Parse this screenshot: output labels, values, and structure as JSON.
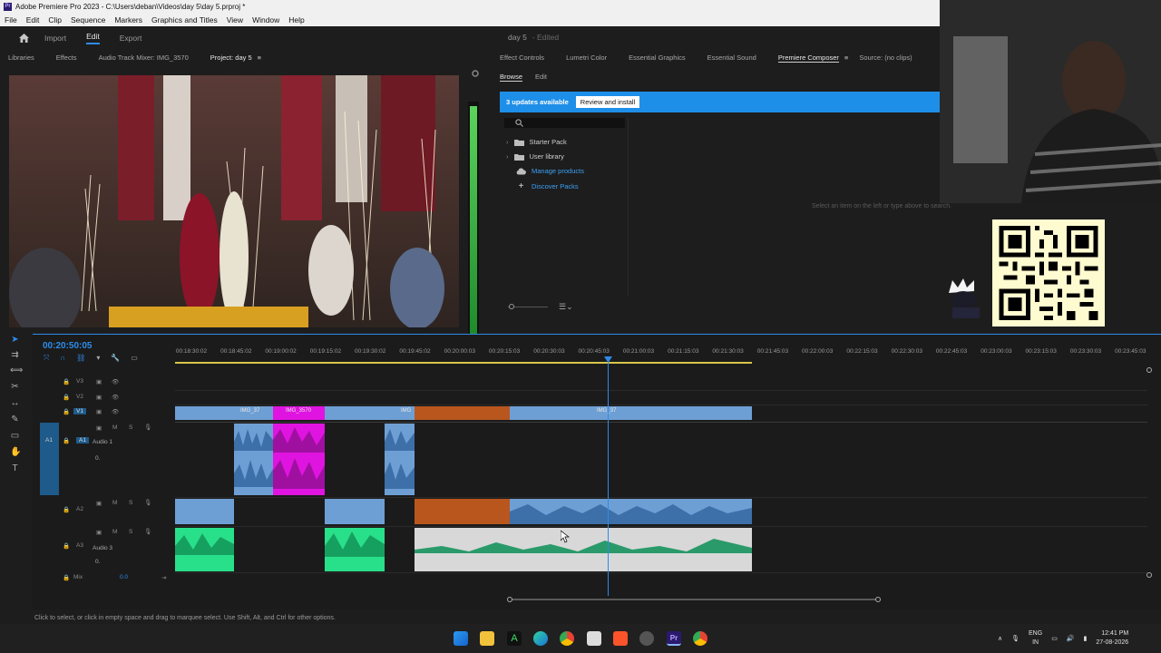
{
  "window": {
    "title": "Adobe Premiere Pro 2023 - C:\\Users\\deban\\Videos\\day 5\\day 5.prproj *"
  },
  "menu": [
    "File",
    "Edit",
    "Clip",
    "Sequence",
    "Markers",
    "Graphics and Titles",
    "View",
    "Window",
    "Help"
  ],
  "workspace": {
    "tabs": [
      "Import",
      "Edit",
      "Export"
    ],
    "active": "Edit",
    "project_name": "day 5",
    "status": "- Edited"
  },
  "left_panel_tabs": [
    "Libraries",
    "Effects",
    "Audio Track Mixer: IMG_3570",
    "Project: day 5"
  ],
  "right_panel_tabs": [
    "Effect Controls",
    "Lumetri Color",
    "Essential Graphics",
    "Essential Sound",
    "Premiere Composer",
    "Source: (no clips)"
  ],
  "right_active_tab": "Premiere Composer",
  "composer": {
    "subtabs": [
      "Browse",
      "Edit"
    ],
    "updates_text": "3 updates available",
    "review_button": "Review and install",
    "tree": [
      {
        "label": "Starter Pack",
        "icon": "folder-icon",
        "link": false
      },
      {
        "label": "User library",
        "icon": "folder-icon",
        "link": false
      },
      {
        "label": "Manage products",
        "icon": "cloud-icon",
        "link": true
      },
      {
        "label": "Discover Packs",
        "icon": "plus-icon",
        "link": true
      }
    ],
    "hint": "Select an item on the left or type above to search."
  },
  "timeline": {
    "timecode": "00:20:50:05",
    "ruler": [
      "00:18:30:02",
      "00:18:45:02",
      "00:19:00:02",
      "00:19:15:02",
      "00:19:30:02",
      "00:19:45:02",
      "00:20:00:03",
      "00:20:15:03",
      "00:20:30:03",
      "00:20:45:03",
      "00:21:00:03",
      "00:21:15:03",
      "00:21:30:03",
      "00:21:45:03",
      "00:22:00:03",
      "00:22:15:03",
      "00:22:30:03",
      "00:22:45:03",
      "00:23:00:03",
      "00:23:15:03",
      "00:23:30:03",
      "00:23:45:03"
    ],
    "tracks": {
      "v3": "V3",
      "v2": "V2",
      "v1": "V1",
      "a1": "A1",
      "a1_name": "Audio 1",
      "a2": "A2",
      "a3": "A3",
      "a3_name": "Audio 3",
      "mix": "Mix",
      "mix_value": "0.0",
      "vol_a1": "0.",
      "vol_a3": "0."
    },
    "clip_names": [
      "IMG_37",
      "IMG_3570",
      "IMG",
      "IMG_37"
    ],
    "colors": {
      "video_clip": "#6e9fd4",
      "magenta_clip": "#e014e0",
      "orange_clip": "#b8561e",
      "green_clip": "#29e08a",
      "white_clip": "#d8d8d8",
      "playhead": "#2d8ceb"
    }
  },
  "status_text": "Click to select, or click in empty space and drag to marquee select. Use Shift, Alt, and Ctrl for other options.",
  "taskbar": {
    "lang_top": "ENG",
    "lang_bottom": "IN",
    "time": "12:41 PM",
    "date": "27-08-2026"
  }
}
